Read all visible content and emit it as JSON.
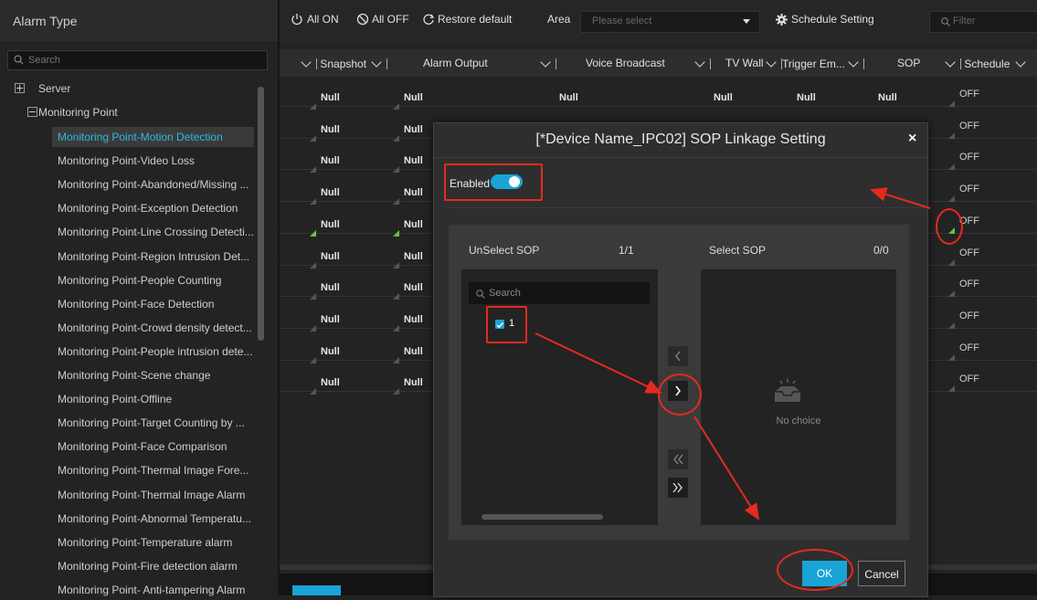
{
  "left": {
    "title": "Alarm Type",
    "search_placeholder": "Search",
    "tree": [
      {
        "label": "Server"
      },
      {
        "label": "Monitoring Point"
      }
    ],
    "items": [
      "Monitoring Point-Motion Detection",
      "Monitoring Point-Video Loss",
      "Monitoring Point-Abandoned/Missing ...",
      "Monitoring Point-Exception Detection",
      "Monitoring Point-Line Crossing Detecti...",
      "Monitoring Point-Region Intrusion Det...",
      "Monitoring Point-People Counting",
      "Monitoring Point-Face Detection",
      "Monitoring Point-Crowd density detect...",
      "Monitoring Point-People intrusion dete...",
      "Monitoring Point-Scene change",
      "Monitoring Point-Offline",
      "Monitoring Point-Target Counting by ...",
      "Monitoring Point-Face Comparison",
      "Monitoring Point-Thermal Image Fore...",
      "Monitoring Point-Thermal Image Alarm",
      "Monitoring Point-Abnormal Temperatu...",
      "Monitoring Point-Temperature alarm",
      "Monitoring Point-Fire detection alarm",
      "Monitoring Point- Anti-tampering Alarm"
    ]
  },
  "toolbar": {
    "all_on": "All ON",
    "all_off": "All OFF",
    "restore": "Restore default",
    "area_label": "Area",
    "area_placeholder": "Please select",
    "schedule_setting": "Schedule Setting",
    "filter_placeholder": "Filter"
  },
  "columns": {
    "snapshot": "Snapshot",
    "alarm_output": "Alarm Output",
    "voice": "Voice Broadcast",
    "tv_wall": "TV Wall",
    "trigger": "Trigger Em...",
    "sop": "SOP",
    "schedule": "Schedule"
  },
  "grid": {
    "null": "Null",
    "off": "OFF"
  },
  "modal": {
    "title": "[*Device Name_IPC02] SOP Linkage Setting",
    "close": "×",
    "enabled_label": "Enabled",
    "enabled": true,
    "unselect_title": "UnSelect SOP",
    "unselect_count": "1/1",
    "select_title": "Select SOP",
    "select_count": "0/0",
    "search_placeholder": "Search",
    "item_label": "1",
    "no_choice": "No choice",
    "ok": "OK",
    "cancel": "Cancel"
  },
  "colors": {
    "accent": "#1aa3d6",
    "annotation": "#e52a1e",
    "selected_text": "#2fb8e0"
  }
}
